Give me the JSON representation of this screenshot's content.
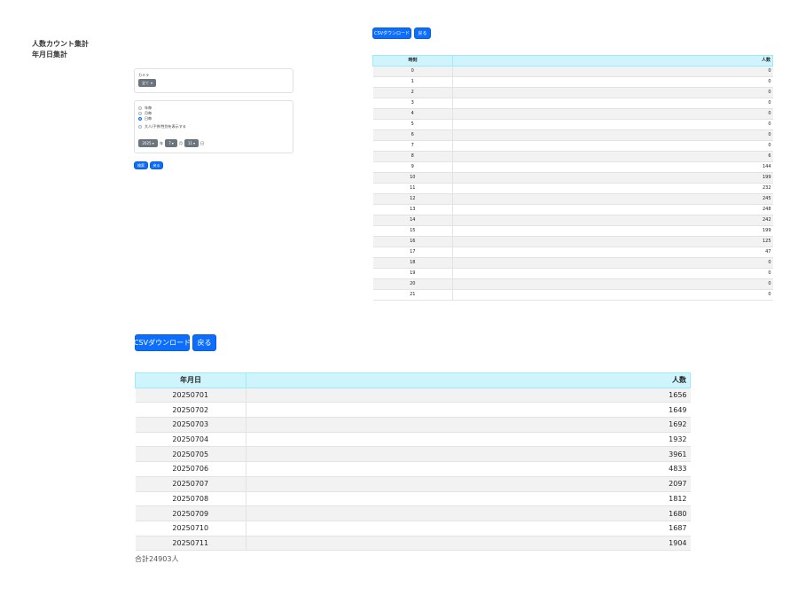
{
  "page": {
    "title_line1": "人数カウント集計",
    "title_line2": "年月日集計"
  },
  "filter": {
    "camera_label": "カメラ",
    "camera_value": "全て",
    "period_options": [
      "年毎",
      "月毎",
      "日毎"
    ],
    "selected_period": "日毎",
    "show_attributes_label": "大人/子供/性別を表示する",
    "year_value": "2025",
    "year_unit": "年",
    "month_value": "7",
    "month_unit": "月",
    "day_value": "11",
    "day_unit": "日",
    "search_label": "検索",
    "back_label": "戻る"
  },
  "hourly": {
    "csv_label": "CSVダウンロード",
    "back_label": "戻る",
    "headers": [
      "時刻",
      "人数"
    ],
    "rows": [
      [
        "0",
        "0"
      ],
      [
        "1",
        "0"
      ],
      [
        "2",
        "0"
      ],
      [
        "3",
        "0"
      ],
      [
        "4",
        "0"
      ],
      [
        "5",
        "0"
      ],
      [
        "6",
        "0"
      ],
      [
        "7",
        "0"
      ],
      [
        "8",
        "6"
      ],
      [
        "9",
        "144"
      ],
      [
        "10",
        "199"
      ],
      [
        "11",
        "232"
      ],
      [
        "12",
        "245"
      ],
      [
        "13",
        "248"
      ],
      [
        "14",
        "242"
      ],
      [
        "15",
        "199"
      ],
      [
        "16",
        "125"
      ],
      [
        "17",
        "47"
      ],
      [
        "18",
        "0"
      ],
      [
        "19",
        "0"
      ],
      [
        "20",
        "0"
      ],
      [
        "21",
        "0"
      ]
    ]
  },
  "daily": {
    "csv_label": "CSVダウンロード",
    "back_label": "戻る",
    "headers": [
      "年月日",
      "人数"
    ],
    "rows": [
      [
        "20250701",
        "1656"
      ],
      [
        "20250702",
        "1649"
      ],
      [
        "20250703",
        "1692"
      ],
      [
        "20250704",
        "1932"
      ],
      [
        "20250705",
        "3961"
      ],
      [
        "20250706",
        "4833"
      ],
      [
        "20250707",
        "2097"
      ],
      [
        "20250708",
        "1812"
      ],
      [
        "20250709",
        "1680"
      ],
      [
        "20250710",
        "1687"
      ],
      [
        "20250711",
        "1904"
      ]
    ],
    "total_text": "合計24903人"
  },
  "colors": {
    "primary": "#0d6efd",
    "secondary": "#6c757d",
    "table_header": "#cff4fc",
    "stripe": "#f2f2f2"
  },
  "icons": {
    "dropdown": "caret-down-icon"
  }
}
